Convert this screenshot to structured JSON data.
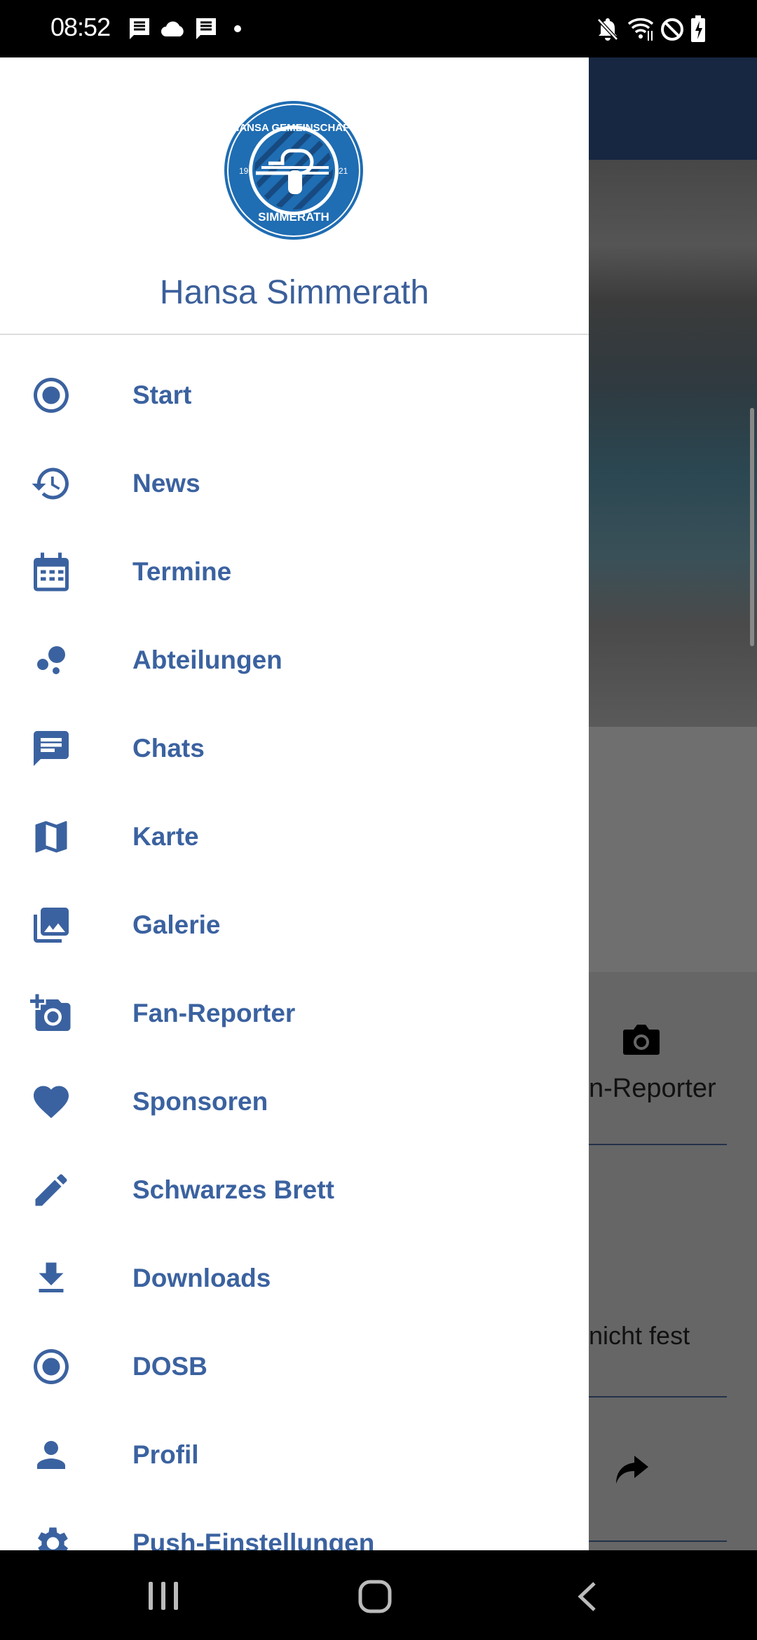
{
  "status_bar": {
    "time": "08:52",
    "icons": [
      "message-icon",
      "cloud-icon",
      "message-icon",
      "dot-icon",
      "mute-icon",
      "wifi-icon",
      "do-not-disturb-icon",
      "battery-charging-icon"
    ]
  },
  "drawer": {
    "title": "Hansa Simmerath",
    "logo_text": "HANSA GEMEINSCHAFT 19 21 SIMMERATH",
    "accent_color": "#3b62a0",
    "items": [
      {
        "label": "Start",
        "icon": "radio-checked-icon"
      },
      {
        "label": "News",
        "icon": "history-icon"
      },
      {
        "label": "Termine",
        "icon": "calendar-icon"
      },
      {
        "label": "Abteilungen",
        "icon": "bubble-chart-icon"
      },
      {
        "label": "Chats",
        "icon": "chat-icon"
      },
      {
        "label": "Karte",
        "icon": "map-icon"
      },
      {
        "label": "Galerie",
        "icon": "photo-library-icon"
      },
      {
        "label": "Fan-Reporter",
        "icon": "add-photo-icon"
      },
      {
        "label": "Sponsoren",
        "icon": "heart-icon"
      },
      {
        "label": "Schwarzes Brett",
        "icon": "pencil-icon"
      },
      {
        "label": "Downloads",
        "icon": "download-icon"
      },
      {
        "label": "DOSB",
        "icon": "radio-checked-icon"
      },
      {
        "label": "Profil",
        "icon": "person-icon"
      },
      {
        "label": "Push-Einstellungen",
        "icon": "gear-icon"
      }
    ]
  },
  "background": {
    "fan_reporter_partial": "n-Reporter",
    "text_partial": "nicht fest"
  },
  "nav_bar": {
    "icons": [
      "recents-icon",
      "home-icon",
      "back-icon"
    ]
  }
}
